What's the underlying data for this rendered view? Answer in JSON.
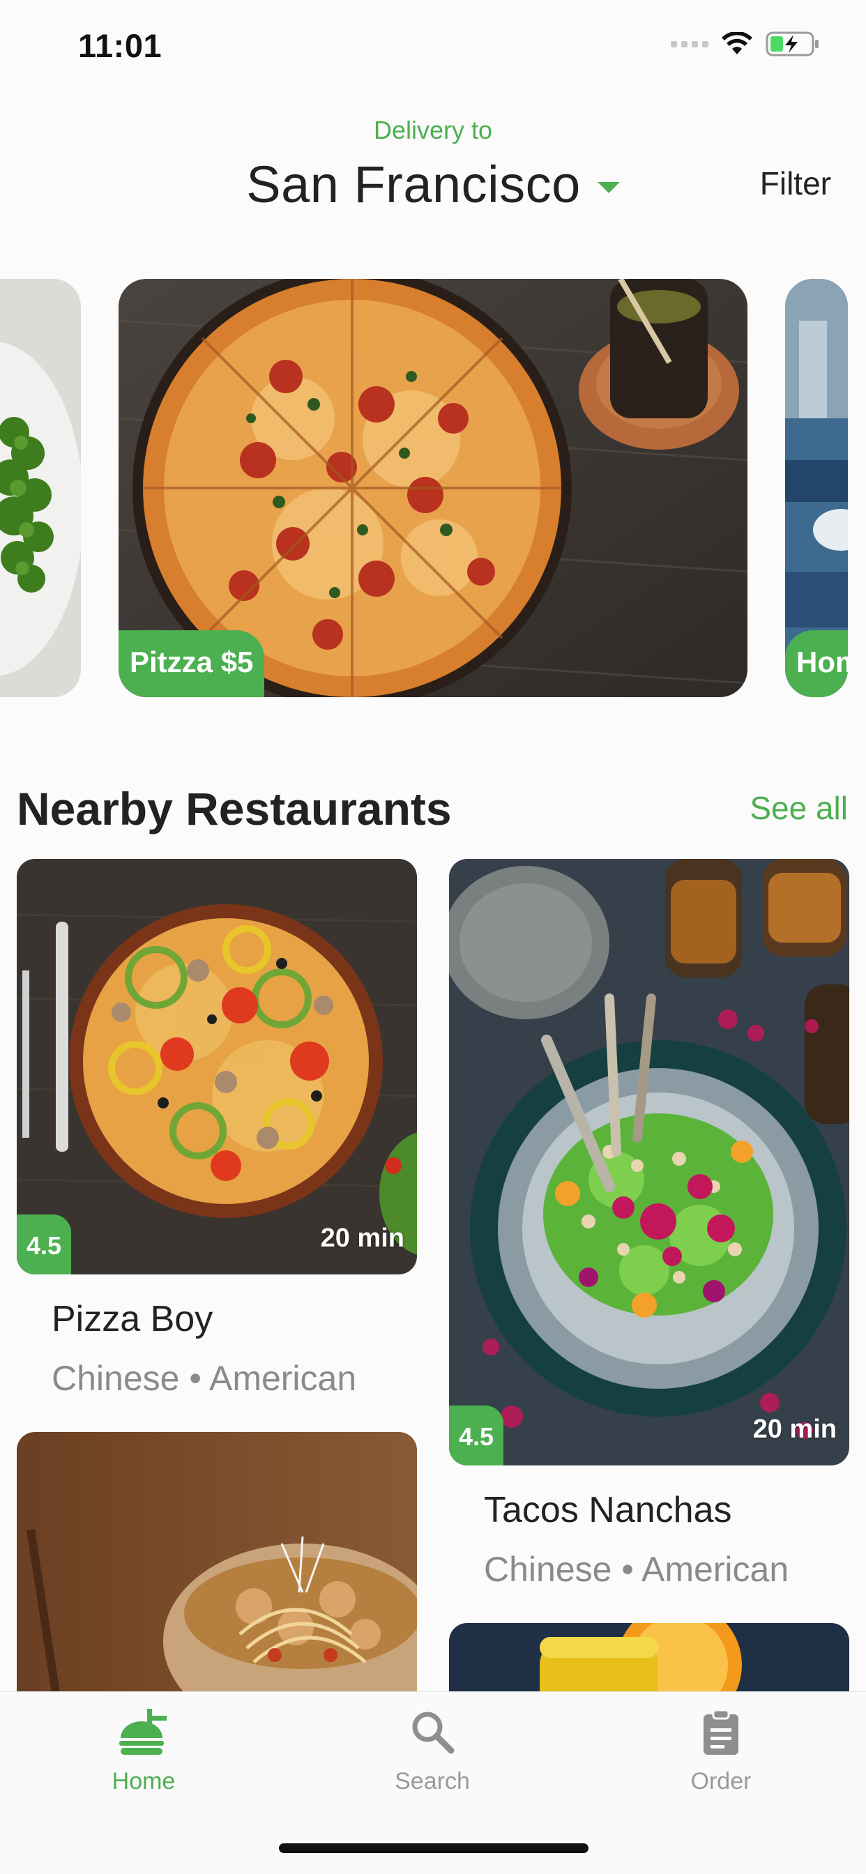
{
  "status_bar": {
    "time": "11:01"
  },
  "header": {
    "delivery_label": "Delivery to",
    "city": "San Francisco",
    "filter_label": "Filter"
  },
  "promos": [
    {
      "label": ""
    },
    {
      "label": "Pitzza $5"
    },
    {
      "label": "Hom"
    }
  ],
  "section": {
    "title": "Nearby Restaurants",
    "see_all_label": "See all"
  },
  "restaurants": [
    {
      "name": "Pizza Boy",
      "cuisine": "Chinese • American",
      "rating": "4.5",
      "time": "20 min"
    },
    {
      "name": "Tacos Nanchas",
      "cuisine": "Chinese • American",
      "rating": "4.5",
      "time": "20 min"
    }
  ],
  "tabs": [
    {
      "label": "Home",
      "icon": "home-burger-icon",
      "active": true
    },
    {
      "label": "Search",
      "icon": "search-icon",
      "active": false
    },
    {
      "label": "Order",
      "icon": "clipboard-icon",
      "active": false
    }
  ],
  "colors": {
    "accent": "#4caf50",
    "text": "#222222",
    "muted": "#8a8a8a",
    "inactive_icon": "#8e8e8e"
  }
}
